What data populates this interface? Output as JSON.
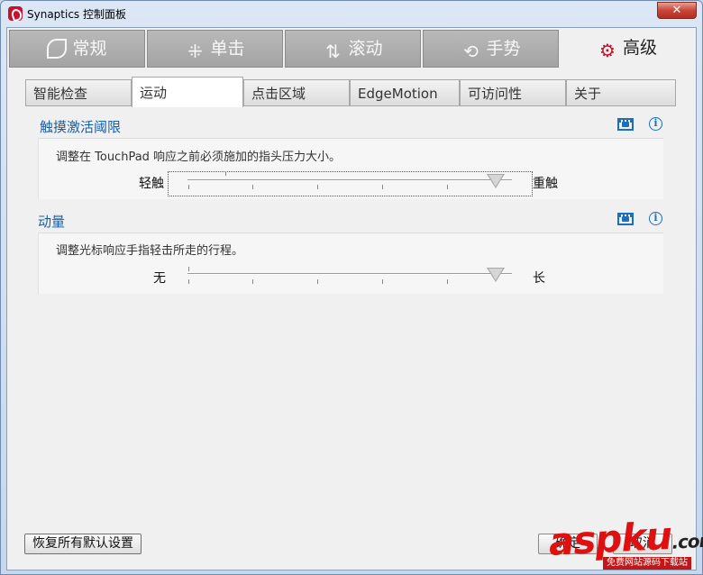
{
  "window": {
    "title": "Synaptics 控制面板",
    "close_label": "✕"
  },
  "main_tabs": [
    {
      "label": "常规",
      "icon": "leaf-icon"
    },
    {
      "label": "单击",
      "icon": "click-icon"
    },
    {
      "label": "滚动",
      "icon": "scroll-arrows-icon"
    },
    {
      "label": "手势",
      "icon": "gesture-icon"
    },
    {
      "label": "高级",
      "icon": "gear-icon",
      "active": true
    }
  ],
  "sub_tabs": [
    {
      "label": "智能检查"
    },
    {
      "label": "运动",
      "active": true
    },
    {
      "label": "点击区域"
    },
    {
      "label": "EdgeMotion"
    },
    {
      "label": "可访问性"
    },
    {
      "label": "关于"
    }
  ],
  "sections": [
    {
      "title": "触摸激活阈限",
      "description": "调整在 TouchPad 响应之前必须施加的指头压力大小。",
      "min_label": "轻触",
      "max_label": "重触",
      "value_fraction": 0.95
    },
    {
      "title": "动量",
      "description": "调整光标响应手指轻击所走的行程。",
      "min_label": "无",
      "max_label": "长",
      "value_fraction": 0.95
    }
  ],
  "buttons": {
    "reset": "恢复所有默认设置",
    "ok": "确定",
    "cancel": "取消"
  },
  "watermark": {
    "brand": "aspku",
    "suffix": ".com",
    "tagline": "免费网站源码下载站"
  },
  "colors": {
    "accent": "#c8102e",
    "section_title": "#1a5fa5",
    "icon_blue": "#1a6fc0"
  }
}
